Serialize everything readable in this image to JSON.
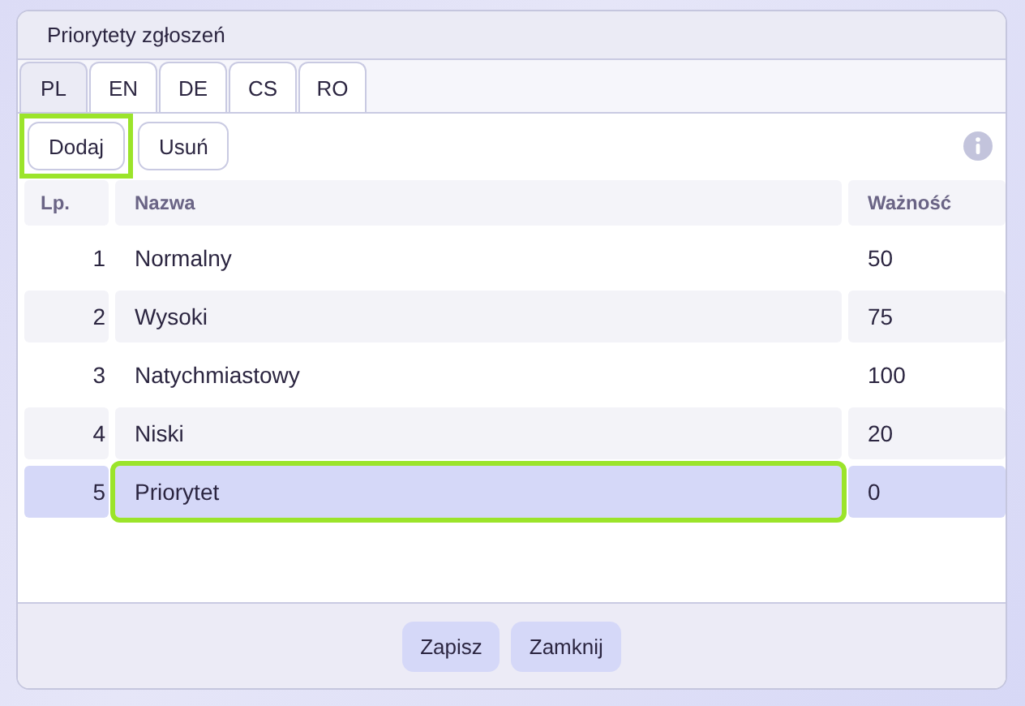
{
  "window": {
    "title": "Priorytety zgłoszeń"
  },
  "tabs": [
    {
      "label": "PL",
      "selected": true
    },
    {
      "label": "EN",
      "selected": false
    },
    {
      "label": "DE",
      "selected": false
    },
    {
      "label": "CS",
      "selected": false
    },
    {
      "label": "RO",
      "selected": false
    }
  ],
  "toolbar": [
    {
      "label": "Dodaj",
      "focused": true
    },
    {
      "label": "Usuń",
      "focused": false
    }
  ],
  "table": {
    "columns": [
      "Lp.",
      "Nazwa",
      "Ważność"
    ],
    "rows": [
      {
        "lp": "1",
        "name": "Normalny",
        "weight": "50",
        "selected": false,
        "focused": false
      },
      {
        "lp": "2",
        "name": "Wysoki",
        "weight": "75",
        "selected": false,
        "focused": false
      },
      {
        "lp": "3",
        "name": "Natychmiastowy",
        "weight": "100",
        "selected": false,
        "focused": false
      },
      {
        "lp": "4",
        "name": "Niski",
        "weight": "20",
        "selected": false,
        "focused": false
      },
      {
        "lp": "5",
        "name": "Priorytet",
        "weight": "0",
        "selected": true,
        "focused": true
      }
    ]
  },
  "buttons": [
    "Zapisz",
    "Zamknij"
  ]
}
